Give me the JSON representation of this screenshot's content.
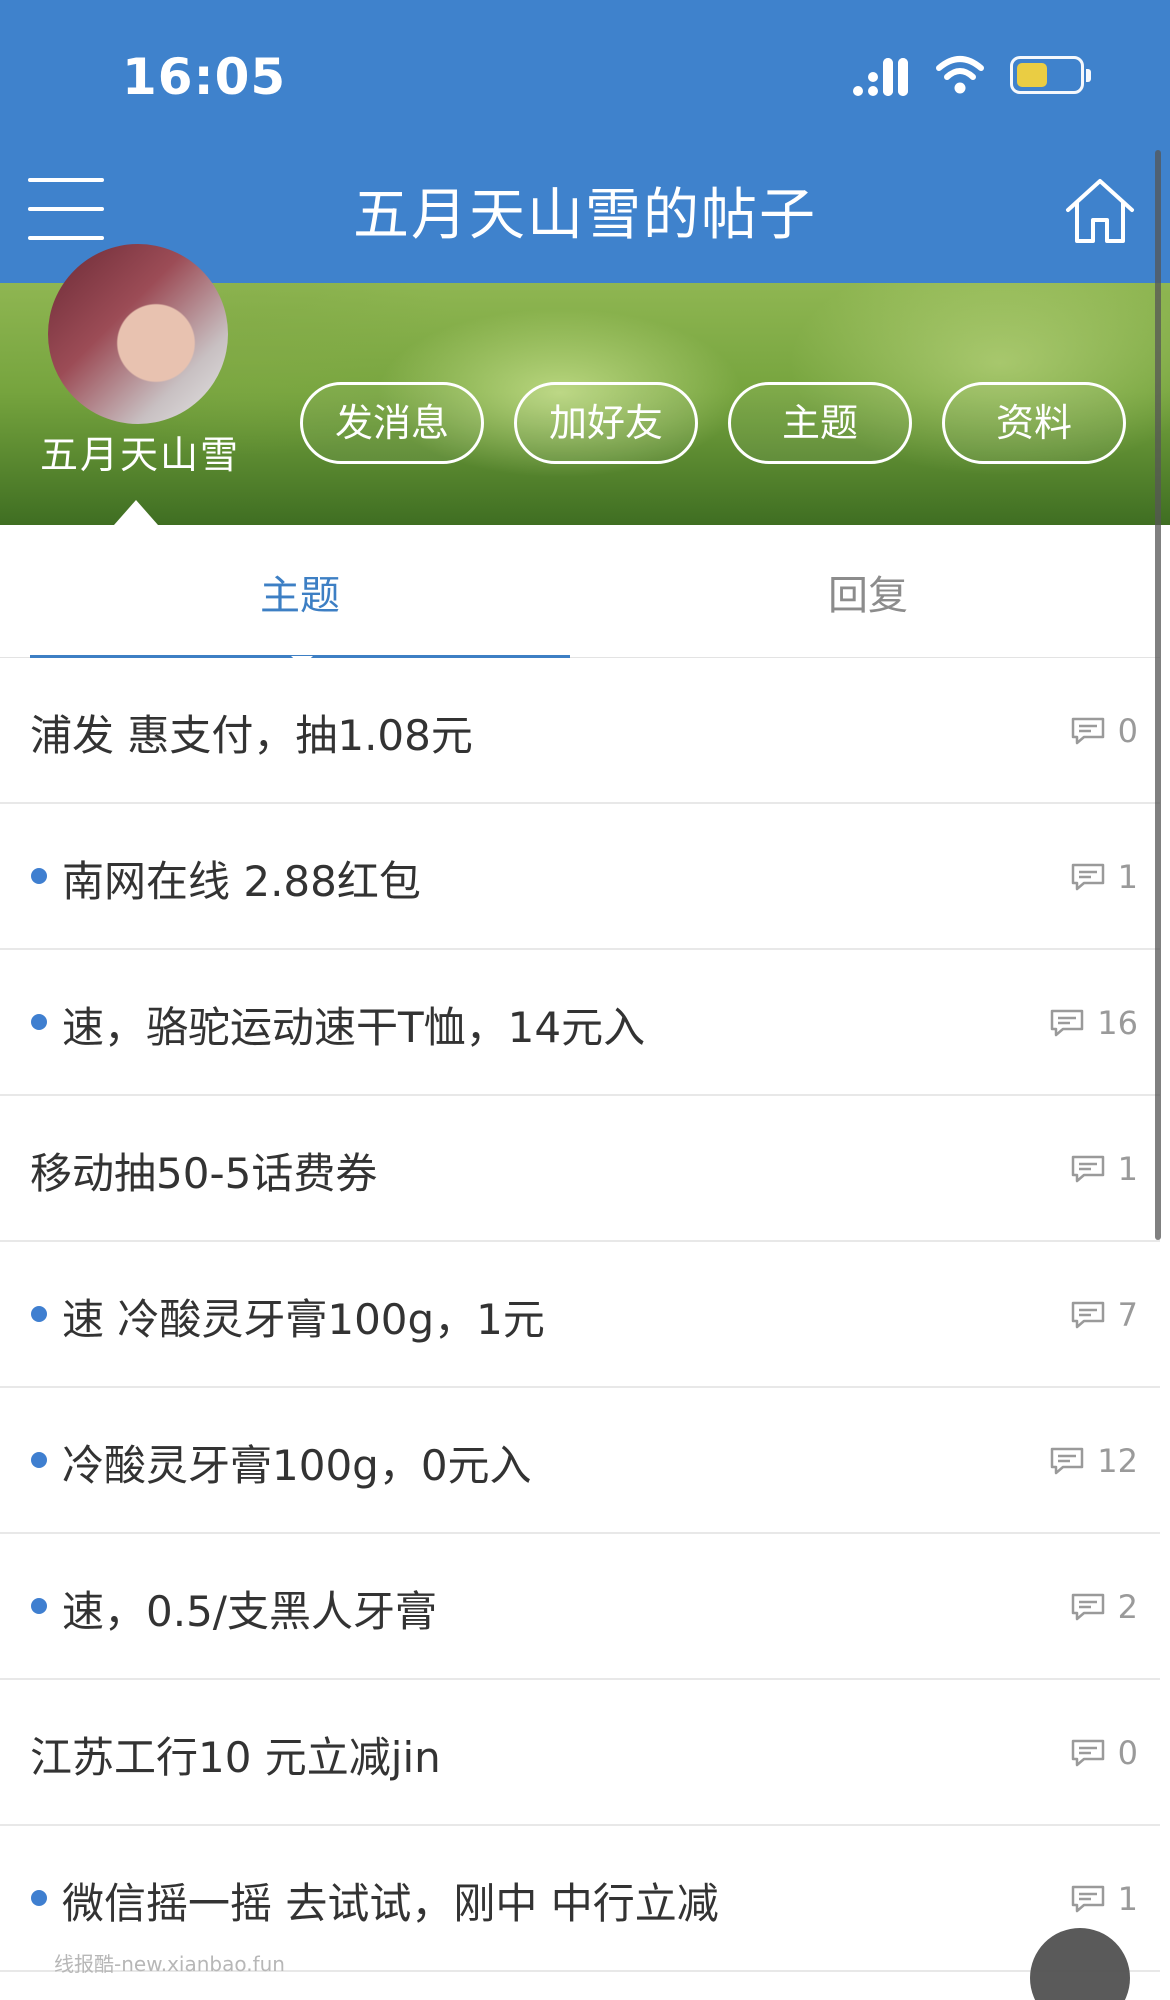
{
  "status_bar": {
    "time": "16:05",
    "icons": [
      "signal-icon",
      "wifi-icon",
      "battery-icon"
    ]
  },
  "nav": {
    "title": "五月天山雪的帖子",
    "left_icon": "menu-icon",
    "right_icon": "home-icon"
  },
  "profile": {
    "username": "五月天山雪",
    "buttons": [
      {
        "label": "发消息"
      },
      {
        "label": "加好友"
      },
      {
        "label": "主题"
      },
      {
        "label": "资料"
      }
    ]
  },
  "tabs": [
    {
      "label": "主题",
      "active": true
    },
    {
      "label": "回复",
      "active": false
    }
  ],
  "posts": [
    {
      "title": "浦发 惠支付，抽1.08元",
      "replies": "0",
      "unread": false
    },
    {
      "title": "南网在线 2.88红包",
      "replies": "1",
      "unread": true
    },
    {
      "title": "速，骆驼运动速干T恤，14元入",
      "replies": "16",
      "unread": true
    },
    {
      "title": "移动抽50-5话费券",
      "replies": "1",
      "unread": false
    },
    {
      "title": "速 冷酸灵牙膏100g，1元",
      "replies": "7",
      "unread": true
    },
    {
      "title": "冷酸灵牙膏100g，0元入",
      "replies": "12",
      "unread": true
    },
    {
      "title": "速，0.5/支黑人牙膏",
      "replies": "2",
      "unread": true
    },
    {
      "title": "江苏工行10 元立减jin",
      "replies": "0",
      "unread": false
    },
    {
      "title": "微信摇一摇 去试试，刚中 中行立减",
      "replies": "1",
      "unread": true
    }
  ],
  "watermark": "线报酷-new.xianbao.fun",
  "colors": {
    "header": "#3f82cc",
    "accent": "#3d7fc4",
    "unread_dot": "#3f7fd0",
    "battery": "#f4d23c"
  }
}
